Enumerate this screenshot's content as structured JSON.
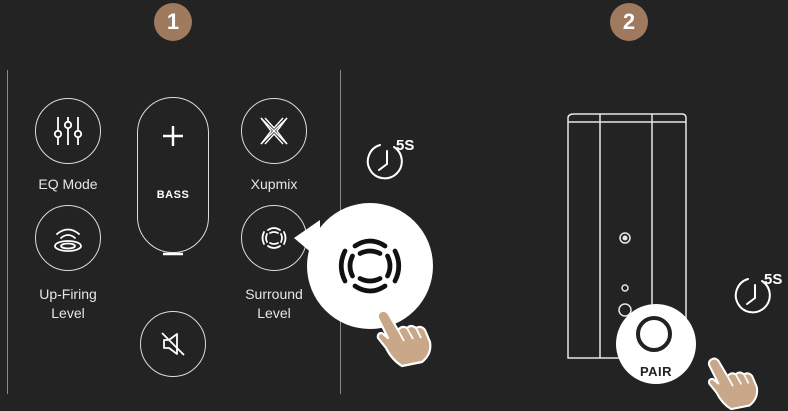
{
  "steps": {
    "one": "1",
    "two": "2"
  },
  "remote": {
    "eq_mode_label": "EQ Mode",
    "bass_label": "BASS",
    "xupmix_label": "Xupmix",
    "upfiring_label_line1": "Up-Firing",
    "upfiring_label_line2": "Level",
    "surround_label_line1": "Surround",
    "surround_label_line2": "Level"
  },
  "timers": {
    "step1_hold": "5S",
    "step2_hold": "5S"
  },
  "speaker": {
    "pair_label": "PAIR"
  },
  "colors": {
    "background": "#232323",
    "badge": "#a07a5e",
    "line": "#dcdcdc",
    "hand": "#c9a88a"
  },
  "icons": {
    "eq": "eq-sliders-icon",
    "upfiring": "upfiring-icon",
    "bass_plus": "plus-icon",
    "bass_minus": "minus-icon",
    "mute": "mute-icon",
    "xupmix": "xupmix-icon",
    "surround": "surround-icon",
    "timer": "timer-icon",
    "hand": "pointing-hand-icon"
  }
}
